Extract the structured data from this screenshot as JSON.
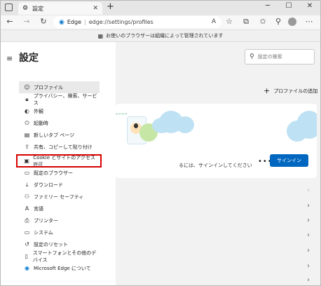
{
  "tab": {
    "title": "設定"
  },
  "address": {
    "app": "Edge",
    "url": "edge://settings/profiles"
  },
  "infobar": {
    "text": "お使いのブラウザーは組織によって管理されています"
  },
  "page": {
    "title": "設定",
    "search_placeholder": "設定の検索"
  },
  "sidebar": {
    "items": [
      {
        "label": "プロファイル",
        "icon": "profile-icon"
      },
      {
        "label": "プライバシー、検索、サービス",
        "icon": "lock-icon"
      },
      {
        "label": "外観",
        "icon": "appearance-icon"
      },
      {
        "label": "起動時",
        "icon": "power-icon"
      },
      {
        "label": "新しいタブ ページ",
        "icon": "new-tab-icon"
      },
      {
        "label": "共有、コピーして貼り付け",
        "icon": "share-icon"
      },
      {
        "label": "Cookie とサイトのアクセス許可",
        "icon": "cookie-icon"
      },
      {
        "label": "既定のブラウザー",
        "icon": "browser-icon"
      },
      {
        "label": "ダウンロード",
        "icon": "download-icon"
      },
      {
        "label": "ファミリー セーフティ",
        "icon": "family-icon"
      },
      {
        "label": "言語",
        "icon": "language-icon"
      },
      {
        "label": "プリンター",
        "icon": "printer-icon"
      },
      {
        "label": "システム",
        "icon": "system-icon"
      },
      {
        "label": "設定のリセット",
        "icon": "reset-icon"
      },
      {
        "label": "スマートフォンとその他のデバイス",
        "icon": "phone-icon"
      },
      {
        "label": "Microsoft Edge について",
        "icon": "edge-icon"
      }
    ]
  },
  "main": {
    "add_profile": "プロファイルの追加",
    "signin_text": "るには、サインインしてください",
    "more": "•••",
    "signin_button": "サインイン"
  },
  "colors": {
    "accent": "#0067c0",
    "highlight": "#d80000"
  }
}
